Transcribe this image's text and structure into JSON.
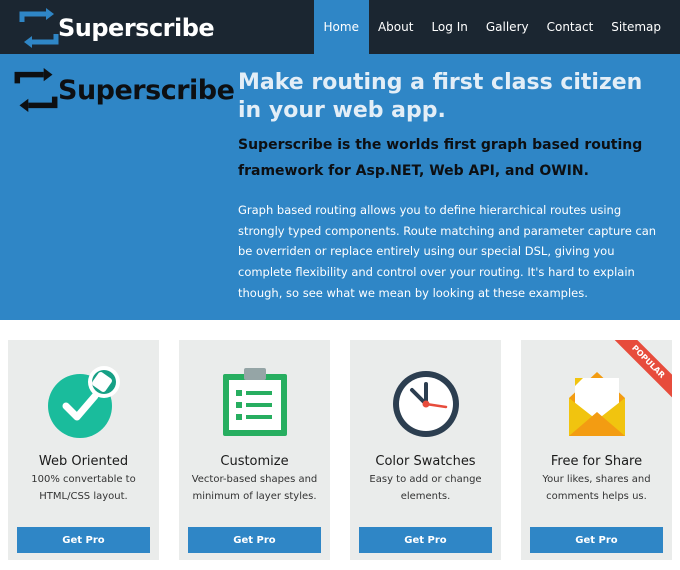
{
  "brand": {
    "name": "Superscribe"
  },
  "nav": {
    "items": [
      {
        "label": "Home",
        "active": true
      },
      {
        "label": "About"
      },
      {
        "label": "Log In"
      },
      {
        "label": "Gallery"
      },
      {
        "label": "Contact"
      },
      {
        "label": "Sitemap"
      }
    ]
  },
  "hero": {
    "logo_text": "Superscribe",
    "title": "Make routing a first class citizen in your web app.",
    "subtitle": "Superscribe is the worlds first graph based routing framework for Asp.NET, Web API, and OWIN.",
    "body": "Graph based routing allows you to define hierarchical routes using strongly typed components. Route matching and parameter capture can be overriden or replace entirely using our special DSL, giving you complete flexibility and control over your routing. It's hard to explain though, so see what we mean by looking at these examples."
  },
  "cards": [
    {
      "icon": "check-badge-icon",
      "title": "Web Oriented",
      "desc": "100% convertable to HTML/CSS layout.",
      "button": "Get Pro"
    },
    {
      "icon": "clipboard-icon",
      "title": "Customize",
      "desc": "Vector-based shapes and minimum of layer styles.",
      "button": "Get Pro"
    },
    {
      "icon": "clock-icon",
      "title": "Color Swatches",
      "desc": "Easy to add or change elements.",
      "button": "Get Pro"
    },
    {
      "icon": "envelope-icon",
      "title": "Free for Share",
      "desc": "Your likes, shares and comments helps us.",
      "button": "Get Pro",
      "ribbon": "POPULAR"
    }
  ],
  "colors": {
    "navbar": "#1b2631",
    "hero": "#2f86c6",
    "accent": "#2f86c6",
    "card": "#eaeceb",
    "ribbon": "#e74c3c"
  }
}
